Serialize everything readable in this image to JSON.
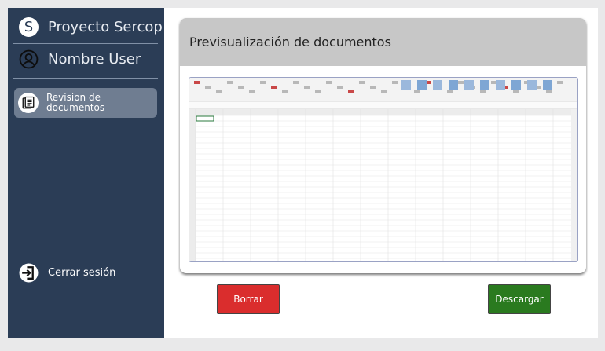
{
  "sidebar": {
    "brand_initial": "S",
    "brand_name": "Proyecto Sercop",
    "user_name": "Nombre User",
    "nav_items": [
      {
        "label": "Revision de\ndocumentos",
        "icon": "document-icon",
        "active": true
      }
    ],
    "logout_label": "Cerrar sesión",
    "logout_icon": "logout-icon"
  },
  "main": {
    "title": "Previsualización de documentos",
    "preview": {
      "type": "spreadsheet-thumbnail",
      "icon": "spreadsheet-preview"
    }
  },
  "actions": {
    "delete_label": "Borrar",
    "download_label": "Descargar"
  },
  "colors": {
    "sidebar": "#2b3d56",
    "active_item": "#6f7d91",
    "header": "#c7c7c7",
    "delete": "#da2d2d",
    "download": "#2a7a1f"
  }
}
